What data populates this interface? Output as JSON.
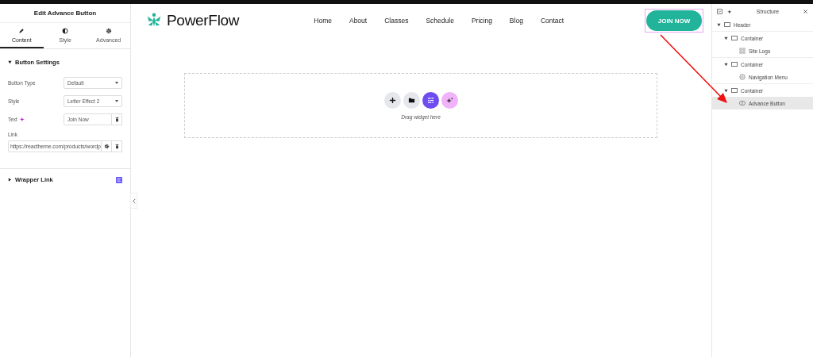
{
  "editor": {
    "title": "Edit Advance Button",
    "tabs": [
      {
        "label": "Content",
        "selected": true
      },
      {
        "label": "Style",
        "selected": false
      },
      {
        "label": "Advanced",
        "selected": false
      }
    ],
    "section": {
      "title": "Button Settings",
      "expanded": true
    },
    "fields": [
      {
        "kind": "select",
        "label": "Button Type",
        "value": "Default"
      },
      {
        "kind": "select",
        "label": "Style",
        "value": "Letter Effect 2"
      },
      {
        "kind": "text",
        "label": "Text",
        "value": "Join Now"
      }
    ],
    "link": {
      "label": "Link",
      "value": "https://reactheme.com/products/wordp"
    },
    "wrapper": {
      "title": "Wrapper Link",
      "expanded": false
    }
  },
  "site": {
    "logo": "PowerFlow",
    "nav": [
      "Home",
      "About",
      "Classes",
      "Schedule",
      "Pricing",
      "Blog",
      "Contact"
    ],
    "cta": "JOIN NOW",
    "dropzone": {
      "hint": "Drag widget here"
    }
  },
  "structure": {
    "title": "Structure",
    "tree": [
      {
        "label": "Header",
        "kind": "container",
        "expanded": true,
        "selected": false,
        "children": [
          {
            "label": "Container",
            "kind": "container",
            "expanded": true,
            "selected": false,
            "children": [
              {
                "label": "Site Logo",
                "kind": "logo",
                "selected": false
              }
            ]
          },
          {
            "label": "Container",
            "kind": "container",
            "expanded": true,
            "selected": false,
            "children": [
              {
                "label": "Navigation Menu",
                "kind": "menu",
                "selected": false
              }
            ]
          },
          {
            "label": "Container",
            "kind": "container",
            "expanded": true,
            "selected": false,
            "children": [
              {
                "label": "Advance Button",
                "kind": "button",
                "selected": true
              }
            ]
          }
        ]
      }
    ]
  }
}
